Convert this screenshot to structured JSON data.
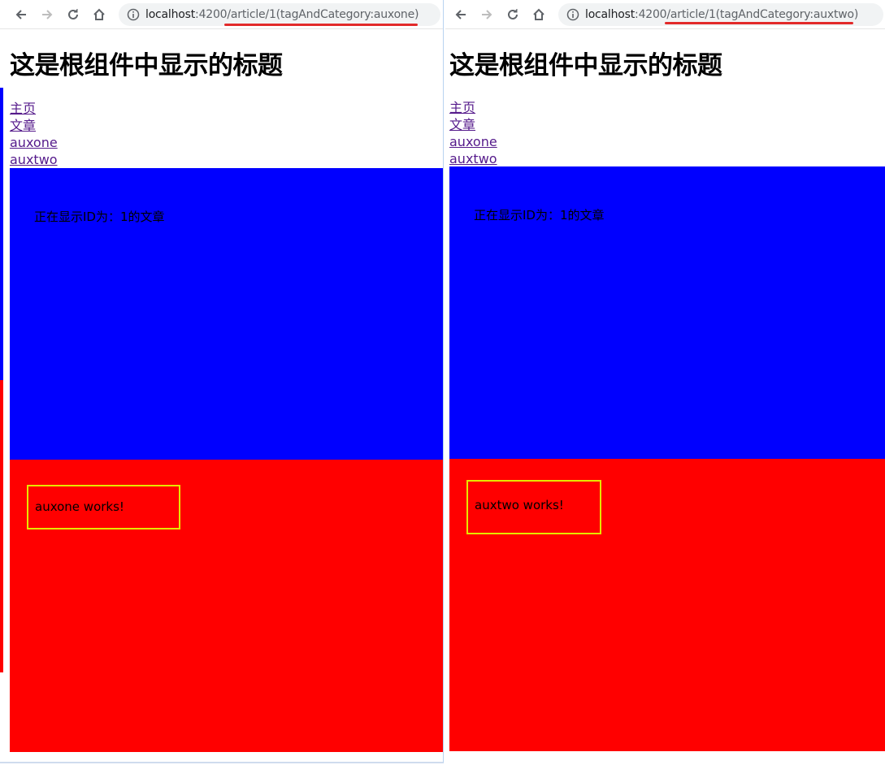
{
  "left": {
    "url": {
      "host": "localhost",
      "port": ":4200",
      "path": "/article/1(tagAndCategory:auxone)"
    },
    "page_title": "这是根组件中显示的标题",
    "nav_links": [
      "主页",
      "文章",
      "auxone",
      "auxtwo"
    ],
    "article_text": "正在显示ID为：1的文章",
    "aux_text": "auxone works!"
  },
  "right": {
    "url": {
      "host": "localhost",
      "port": ":4200",
      "path": "/article/1(tagAndCategory:auxtwo)"
    },
    "page_title": "这是根组件中显示的标题",
    "nav_links": [
      "主页",
      "文章",
      "auxone",
      "auxtwo"
    ],
    "article_text": "正在显示ID为：1的文章",
    "aux_text": "auxtwo works!"
  },
  "colors": {
    "article_bg": "#0000ff",
    "aux_bg": "#ff0000",
    "aux_border": "#e6e600",
    "link": "#551a8b",
    "url_highlight": "#e22a2a"
  },
  "icons": [
    "back-arrow-icon",
    "forward-arrow-icon",
    "reload-icon",
    "home-icon",
    "info-icon"
  ]
}
